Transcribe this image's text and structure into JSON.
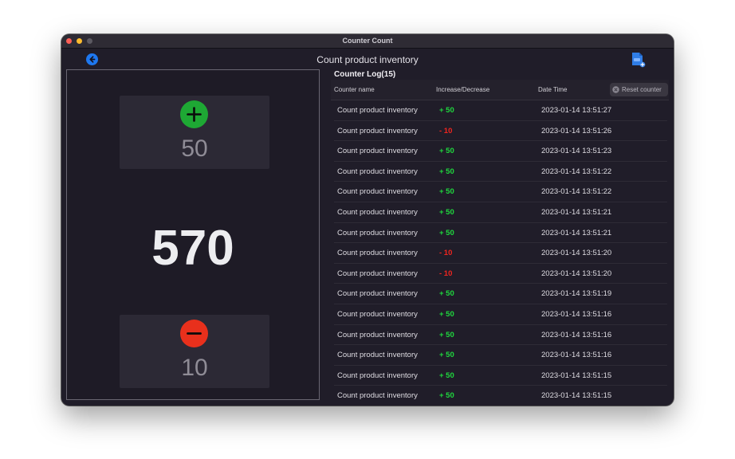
{
  "window": {
    "title": "Counter Count"
  },
  "header": {
    "title": "Count product inventory"
  },
  "counter": {
    "increment_value": "50",
    "total": "570",
    "decrement_value": "10"
  },
  "log": {
    "title": "Counter Log(15)",
    "columns": {
      "name": "Counter name",
      "change": "Increase/Decrease",
      "time": "Date Time"
    },
    "reset_label": "Reset counter",
    "rows": [
      {
        "name": "Count product inventory",
        "change": "+ 50",
        "direction": "up",
        "time": "2023-01-14 13:51:27"
      },
      {
        "name": "Count product inventory",
        "change": "- 10",
        "direction": "down",
        "time": "2023-01-14 13:51:26"
      },
      {
        "name": "Count product inventory",
        "change": "+ 50",
        "direction": "up",
        "time": "2023-01-14 13:51:23"
      },
      {
        "name": "Count product inventory",
        "change": "+ 50",
        "direction": "up",
        "time": "2023-01-14 13:51:22"
      },
      {
        "name": "Count product inventory",
        "change": "+ 50",
        "direction": "up",
        "time": "2023-01-14 13:51:22"
      },
      {
        "name": "Count product inventory",
        "change": "+ 50",
        "direction": "up",
        "time": "2023-01-14 13:51:21"
      },
      {
        "name": "Count product inventory",
        "change": "+ 50",
        "direction": "up",
        "time": "2023-01-14 13:51:21"
      },
      {
        "name": "Count product inventory",
        "change": "- 10",
        "direction": "down",
        "time": "2023-01-14 13:51:20"
      },
      {
        "name": "Count product inventory",
        "change": "- 10",
        "direction": "down",
        "time": "2023-01-14 13:51:20"
      },
      {
        "name": "Count product inventory",
        "change": "+ 50",
        "direction": "up",
        "time": "2023-01-14 13:51:19"
      },
      {
        "name": "Count product inventory",
        "change": "+ 50",
        "direction": "up",
        "time": "2023-01-14 13:51:16"
      },
      {
        "name": "Count product inventory",
        "change": "+ 50",
        "direction": "up",
        "time": "2023-01-14 13:51:16"
      },
      {
        "name": "Count product inventory",
        "change": "+ 50",
        "direction": "up",
        "time": "2023-01-14 13:51:16"
      },
      {
        "name": "Count product inventory",
        "change": "+ 50",
        "direction": "up",
        "time": "2023-01-14 13:51:15"
      },
      {
        "name": "Count product inventory",
        "change": "+ 50",
        "direction": "up",
        "time": "2023-01-14 13:51:15"
      }
    ]
  },
  "icons": {
    "back": "arrow-left-circle-icon",
    "export": "csv-file-export-icon",
    "increment": "plus-icon",
    "decrement": "minus-icon",
    "reset": "reset-icon"
  },
  "colors": {
    "accent": "#1e78f0",
    "increase": "#1fd83e",
    "decrease": "#f0251f",
    "plus_button": "#1ea834",
    "minus_button": "#e8301c"
  }
}
